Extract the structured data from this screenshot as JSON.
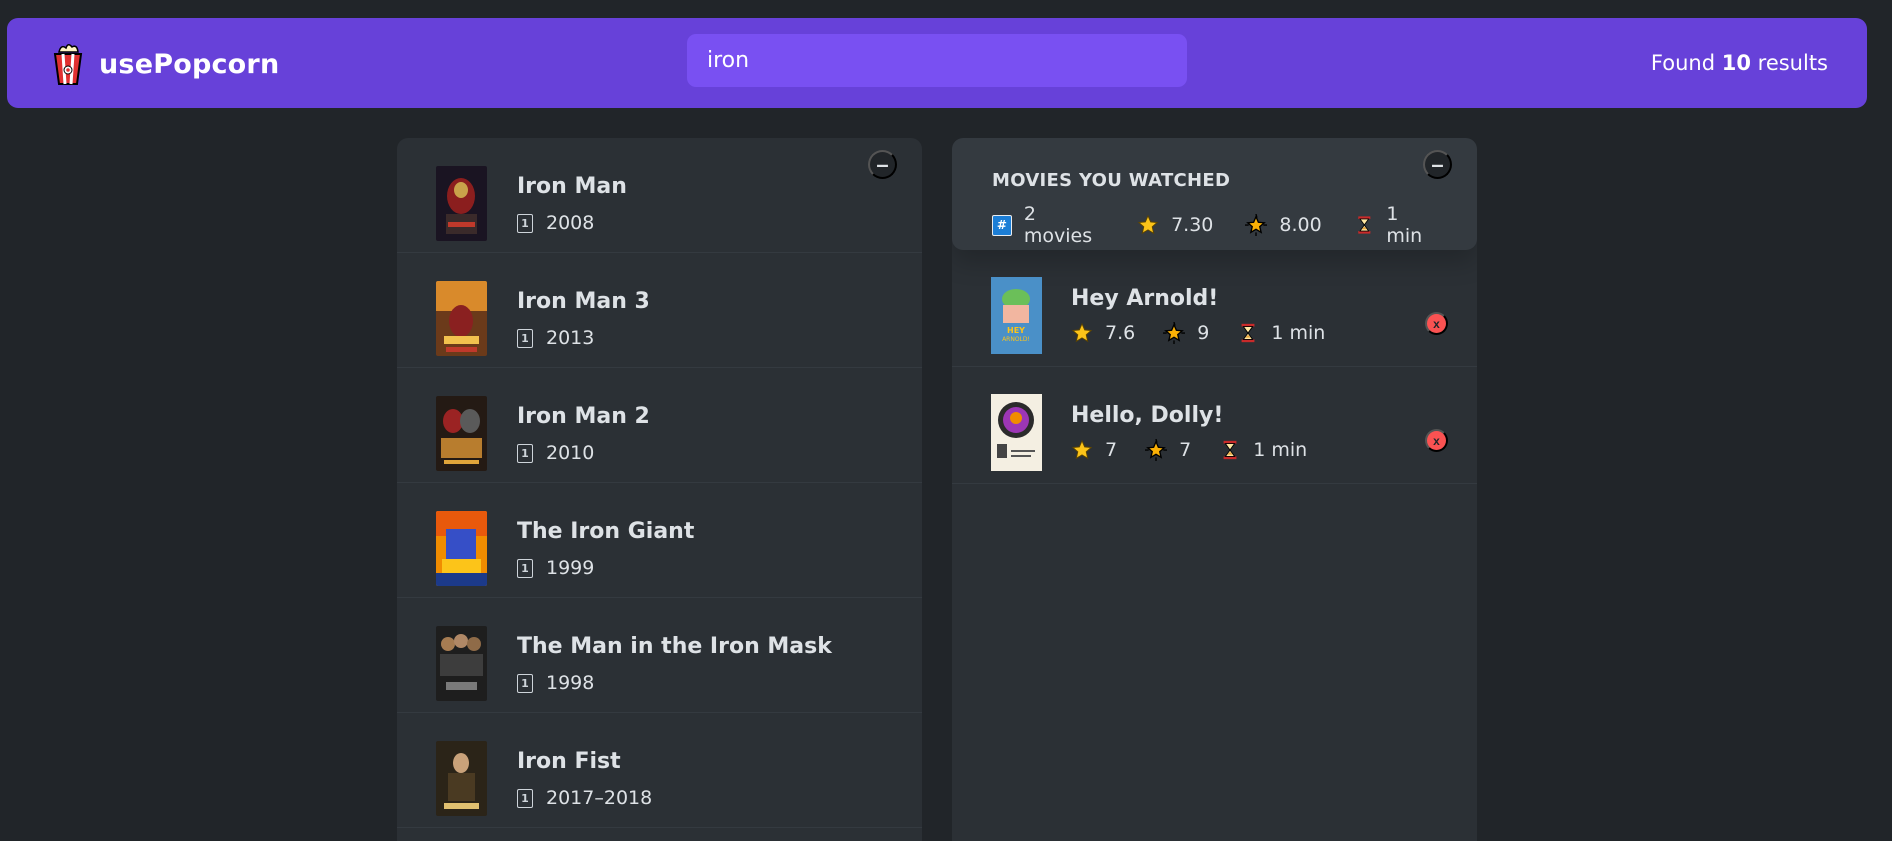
{
  "nav": {
    "logo_text": "usePopcorn",
    "search_value": "iron",
    "results_prefix": "Found ",
    "results_count": "10",
    "results_suffix": " results"
  },
  "list_toggle": "–",
  "movies": [
    {
      "title": "Iron Man",
      "year": "2008"
    },
    {
      "title": "Iron Man 3",
      "year": "2013"
    },
    {
      "title": "Iron Man 2",
      "year": "2010"
    },
    {
      "title": "The Iron Giant",
      "year": "1999"
    },
    {
      "title": "The Man in the Iron Mask",
      "year": "1998"
    },
    {
      "title": "Iron Fist",
      "year": "2017–2018"
    }
  ],
  "watched_summary": {
    "title": "MOVIES YOU WATCHED",
    "num_movies": "2 movies",
    "avg_imdb": "7.30",
    "avg_user": "8.00",
    "avg_runtime": "1 min",
    "toggle": "–"
  },
  "watched": [
    {
      "title": "Hey Arnold!",
      "imdb": "7.6",
      "user": "9",
      "runtime": "1 min",
      "delete": "x"
    },
    {
      "title": "Hello, Dolly!",
      "imdb": "7",
      "user": "7",
      "runtime": "1 min",
      "delete": "x"
    }
  ],
  "icons": {
    "logo": "popcorn-icon",
    "calendar": "calendar-icon",
    "count": "hash-icon",
    "imdb": "star-icon",
    "user": "glowing-star-icon",
    "runtime": "hourglass-icon"
  },
  "colors": {
    "nav": "#6741d9",
    "search": "#7950f2",
    "background": "#212529",
    "box": "#2b3035",
    "summary": "#343a40",
    "delete": "#fa5252"
  }
}
